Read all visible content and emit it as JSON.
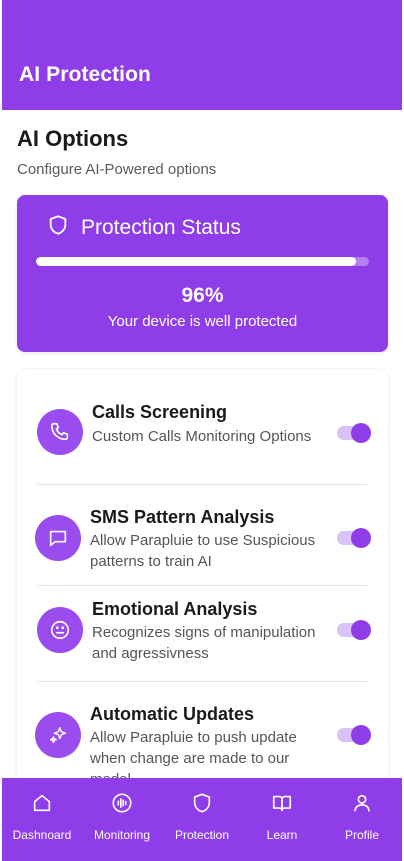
{
  "header": {
    "title": "AI Protection"
  },
  "section": {
    "title": "AI Options",
    "subtitle": "Configure AI-Powered options"
  },
  "status": {
    "title": "Protection Status",
    "icon": "shield-icon",
    "progress": 0.96,
    "percent_label": "96%",
    "message": "Your device is well protected"
  },
  "options": [
    {
      "title": "Calls Screening",
      "description": "Custom Calls Monitoring Options",
      "icon": "phone-icon",
      "enabled": true
    },
    {
      "title": "SMS Pattern Analysis",
      "description": "Allow Parapluie to use Suspicious patterns to train AI",
      "icon": "message-icon",
      "enabled": true
    },
    {
      "title": "Emotional Analysis",
      "description": "Recognizes signs of manipulation and agressivness",
      "icon": "face-icon",
      "enabled": true
    },
    {
      "title": "Automatic Updates",
      "description": "Allow Parapluie to push update when change are made to our model",
      "icon": "sparkle-icon",
      "enabled": true
    }
  ],
  "nav": [
    {
      "label": "Dashnoard",
      "icon": "home-icon"
    },
    {
      "label": "Monitoring",
      "icon": "audio-wave-icon"
    },
    {
      "label": "Protection",
      "icon": "shield-icon"
    },
    {
      "label": "Learn",
      "icon": "book-icon"
    },
    {
      "label": "Profile",
      "icon": "user-icon"
    }
  ],
  "colors": {
    "accent": "#8f3de8",
    "icon_bg": "#9a4cee",
    "toggle_track": "#d8c2f7"
  }
}
